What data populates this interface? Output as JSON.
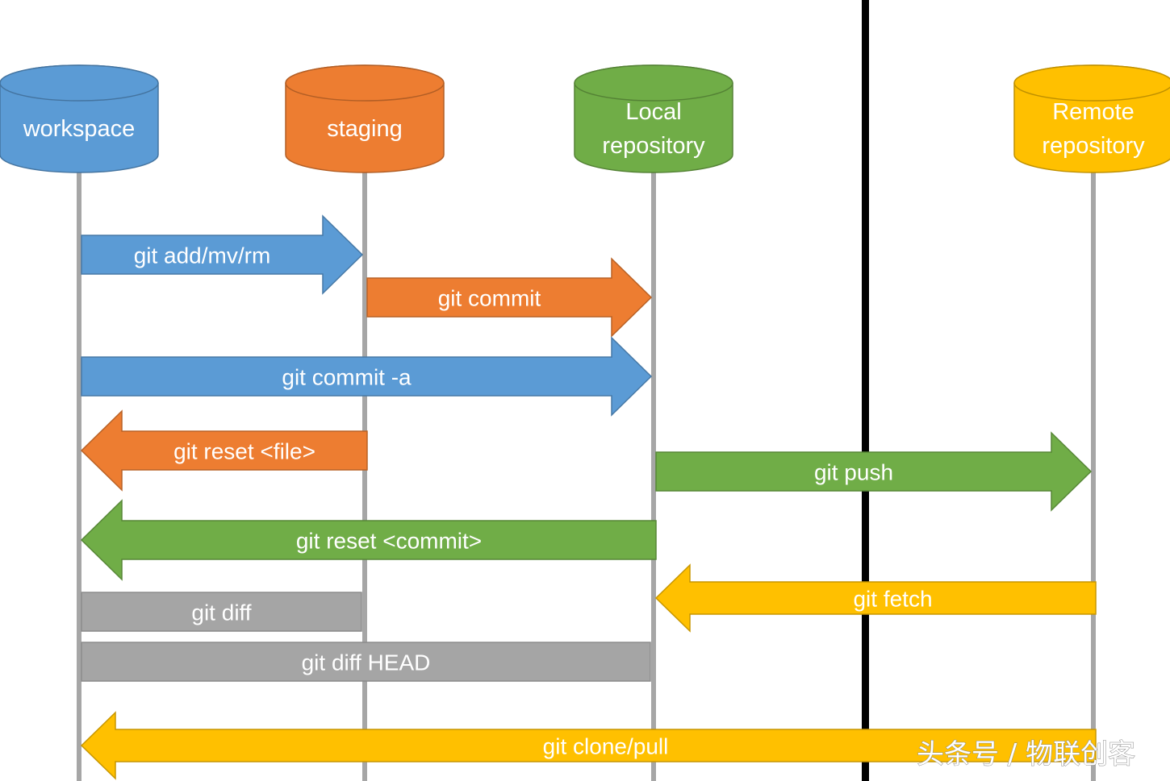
{
  "colors": {
    "workspace": "#5b9bd5",
    "staging": "#ed7d31",
    "local": "#70ad47",
    "remote": "#ffc000",
    "diff": "#a5a5a5",
    "lifeline": "#a6a6a6",
    "divider": "#000000"
  },
  "nodes": [
    {
      "id": "workspace",
      "lines": [
        "workspace"
      ],
      "color_key": "workspace"
    },
    {
      "id": "staging",
      "lines": [
        "staging"
      ],
      "color_key": "staging"
    },
    {
      "id": "local",
      "lines": [
        "Local",
        "repository"
      ],
      "color_key": "local"
    },
    {
      "id": "remote",
      "lines": [
        "Remote",
        "repository"
      ],
      "color_key": "remote"
    }
  ],
  "commands": [
    {
      "label": "git add/mv/rm",
      "from": "workspace",
      "to": "staging",
      "kind": "arrow",
      "color_key": "workspace"
    },
    {
      "label": "git commit",
      "from": "staging",
      "to": "local",
      "kind": "arrow",
      "color_key": "staging"
    },
    {
      "label": "git commit -a",
      "from": "workspace",
      "to": "local",
      "kind": "arrow",
      "color_key": "workspace"
    },
    {
      "label": "git reset <file>",
      "from": "staging",
      "to": "workspace",
      "kind": "arrow",
      "color_key": "staging"
    },
    {
      "label": "git push",
      "from": "local",
      "to": "remote",
      "kind": "arrow",
      "color_key": "local"
    },
    {
      "label": "git reset <commit>",
      "from": "local",
      "to": "workspace",
      "kind": "arrow",
      "color_key": "local"
    },
    {
      "label": "git fetch",
      "from": "remote",
      "to": "local",
      "kind": "arrow",
      "color_key": "remote"
    },
    {
      "label": "git diff",
      "from": "workspace",
      "to": "staging",
      "kind": "bar",
      "color_key": "diff"
    },
    {
      "label": "git diff HEAD",
      "from": "workspace",
      "to": "local",
      "kind": "bar",
      "color_key": "diff"
    },
    {
      "label": "git clone/pull",
      "from": "remote",
      "to": "workspace",
      "kind": "arrow",
      "color_key": "remote"
    }
  ],
  "watermark": "头条号 / 物联创客"
}
